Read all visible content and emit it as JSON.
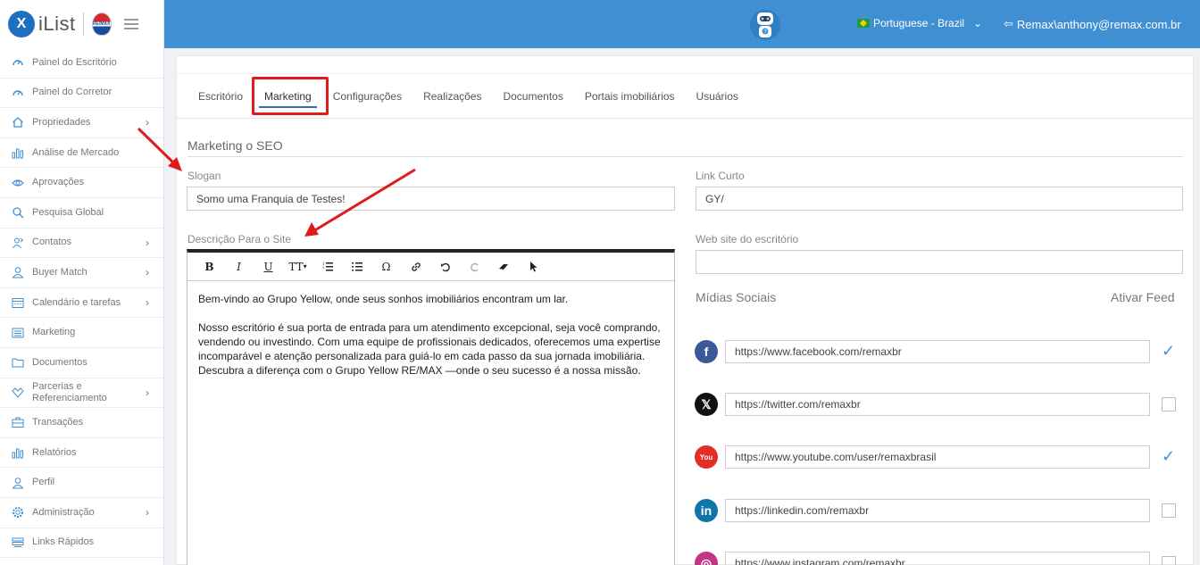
{
  "brand": {
    "logo_letter": "X",
    "logo_text": "iList",
    "partner_badge": "RE/MAX"
  },
  "topbar": {
    "language": "Portuguese - Brazil",
    "user": "Remax\\anthony@remax.com.br"
  },
  "sidebar": {
    "items": [
      {
        "label": "Painel do Escritório",
        "icon": "gauge-icon",
        "chevron": false
      },
      {
        "label": "Painel do Corretor",
        "icon": "gauge-icon",
        "chevron": false
      },
      {
        "label": "Propriedades",
        "icon": "home-icon",
        "chevron": true
      },
      {
        "label": "Análise de Mercado",
        "icon": "bar-chart-icon",
        "chevron": false
      },
      {
        "label": "Aprovações",
        "icon": "eye-icon",
        "chevron": false
      },
      {
        "label": "Pesquisa Global",
        "icon": "search-icon",
        "chevron": false
      },
      {
        "label": "Contatos",
        "icon": "contacts-icon",
        "chevron": true
      },
      {
        "label": "Buyer Match",
        "icon": "person-icon",
        "chevron": true
      },
      {
        "label": "Calendário e tarefas",
        "icon": "calendar-icon",
        "chevron": true
      },
      {
        "label": "Marketing",
        "icon": "newspaper-icon",
        "chevron": false
      },
      {
        "label": "Documentos",
        "icon": "folder-icon",
        "chevron": false
      },
      {
        "label": "Parcerias e Referenciamento",
        "icon": "handshake-icon",
        "chevron": true
      },
      {
        "label": "Transações",
        "icon": "briefcase-icon",
        "chevron": false
      },
      {
        "label": "Relatórios",
        "icon": "bar-chart-icon",
        "chevron": false
      },
      {
        "label": "Perfil",
        "icon": "person-icon",
        "chevron": false
      },
      {
        "label": "Administração",
        "icon": "gear-icon",
        "chevron": true
      },
      {
        "label": "Links Rápidos",
        "icon": "links-icon",
        "chevron": false
      }
    ]
  },
  "tabs": [
    "Escritório",
    "Marketing",
    "Configurações",
    "Realizações",
    "Documentos",
    "Portais imobiliários",
    "Usuários"
  ],
  "active_tab": "Marketing",
  "form": {
    "section_title": "Marketing o SEO",
    "slogan_label": "Slogan",
    "slogan_value": "Somo uma Franquia de Testes!",
    "link_label": "Link Curto",
    "link_value": "GY/",
    "desc_label": "Descrição Para o Site",
    "website_label": "Web site do escritório",
    "website_value": "",
    "desc_paragraph1": "Bem-vindo ao Grupo Yellow, onde seus sonhos imobiliários encontram um lar.",
    "desc_paragraph2": "Nosso escritório é sua porta de entrada para um atendimento excepcional, seja você comprando, vendendo ou investindo. Com uma equipe de profissionais dedicados, oferecemos uma expertise incomparável e atenção personalizada para guiá-lo em cada passo da sua jornada imobiliária. Descubra a diferença com o Grupo Yellow RE/MAX —onde o seu sucesso é a nossa missão."
  },
  "editor_toolbar": {
    "bold": "B",
    "italic": "I",
    "underline": "U",
    "text_size": "TT",
    "special_char": "Ω"
  },
  "social": {
    "title": "Mídias Sociais",
    "feed_label": "Ativar Feed",
    "items": [
      {
        "icon": "facebook-icon",
        "glyph": "f",
        "color": "#3b5998",
        "url": "https://www.facebook.com/remaxbr",
        "checked": true
      },
      {
        "icon": "x-twitter-icon",
        "glyph": "𝕏",
        "color": "#111111",
        "url": "https://twitter.com/remaxbr",
        "checked": false
      },
      {
        "icon": "youtube-icon",
        "glyph": "You",
        "color": "#e52d27",
        "url": "https://www.youtube.com/user/remaxbrasil",
        "checked": true
      },
      {
        "icon": "linkedin-icon",
        "glyph": "in",
        "color": "#0e76a8",
        "url": "https://linkedin.com/remaxbr",
        "checked": false
      },
      {
        "icon": "instagram-icon",
        "glyph": "◎",
        "color": "#c13584",
        "url": "https://www.instagram.com/remaxbr",
        "checked": false
      }
    ]
  },
  "colors": {
    "topbar": "#3f8fd2",
    "highlight": "#e01b1b",
    "accent": "#3f8fd2"
  }
}
